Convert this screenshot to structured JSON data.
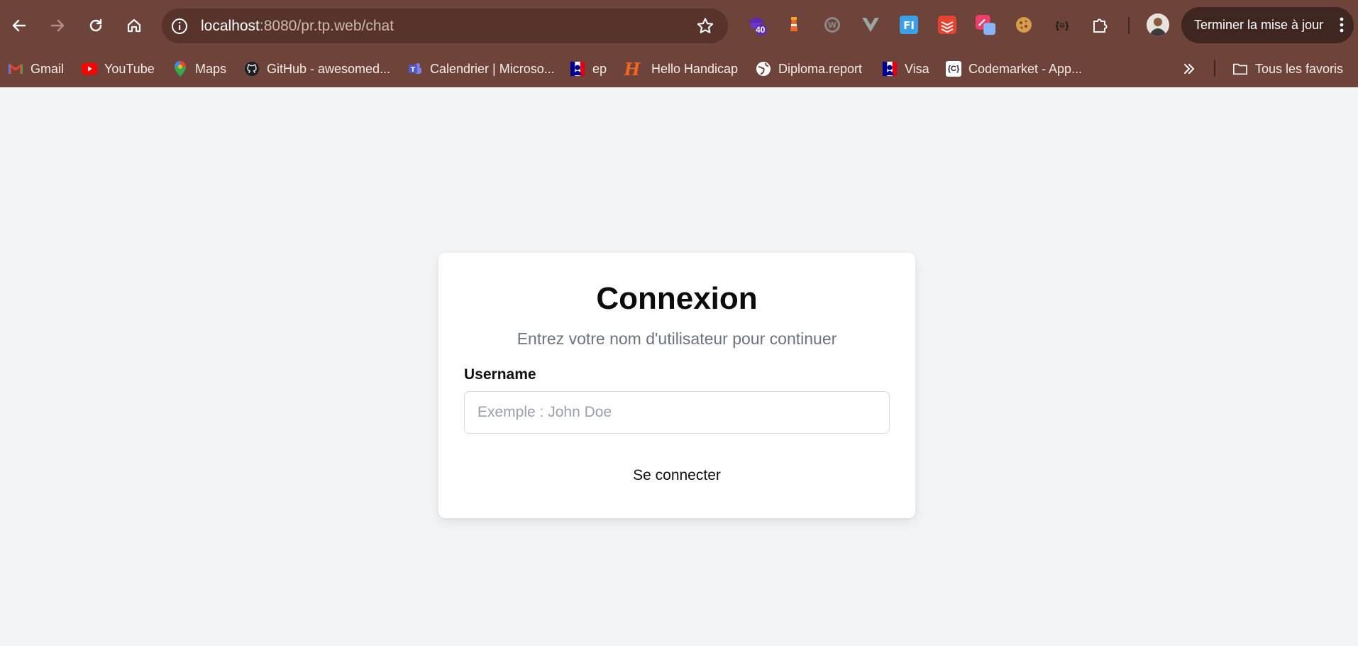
{
  "browser": {
    "url_host": "localhost",
    "url_rest": ":8080/pr.tp.web/chat",
    "extension_badge": "40",
    "extension_text_icon": "{≡}",
    "update_button_label": "Terminer la mise à jour",
    "bookmarks": [
      {
        "label": "Gmail",
        "icon": "gmail-icon"
      },
      {
        "label": "YouTube",
        "icon": "youtube-icon"
      },
      {
        "label": "Maps",
        "icon": "maps-icon"
      },
      {
        "label": "GitHub - awesomed...",
        "icon": "github-icon"
      },
      {
        "label": "Calendrier | Microso...",
        "icon": "teams-icon"
      },
      {
        "label": "ep",
        "icon": "marianne-icon"
      },
      {
        "label": "Hello Handicap",
        "icon": "hello-handicap-icon"
      },
      {
        "label": "Diploma.report",
        "icon": "globe-icon"
      },
      {
        "label": "Visa",
        "icon": "marianne-icon"
      },
      {
        "label": "Codemarket - App...",
        "icon": "codemarket-icon"
      }
    ],
    "all_bookmarks_label": "Tous les favoris",
    "colors": {
      "chrome": "#6e4339",
      "omnibox": "#57332b"
    }
  },
  "login": {
    "title": "Connexion",
    "subtitle": "Entrez votre nom d'utilisateur pour continuer",
    "username_label": "Username",
    "username_placeholder": "Exemple : John Doe",
    "username_value": "",
    "submit_label": "Se connecter"
  }
}
